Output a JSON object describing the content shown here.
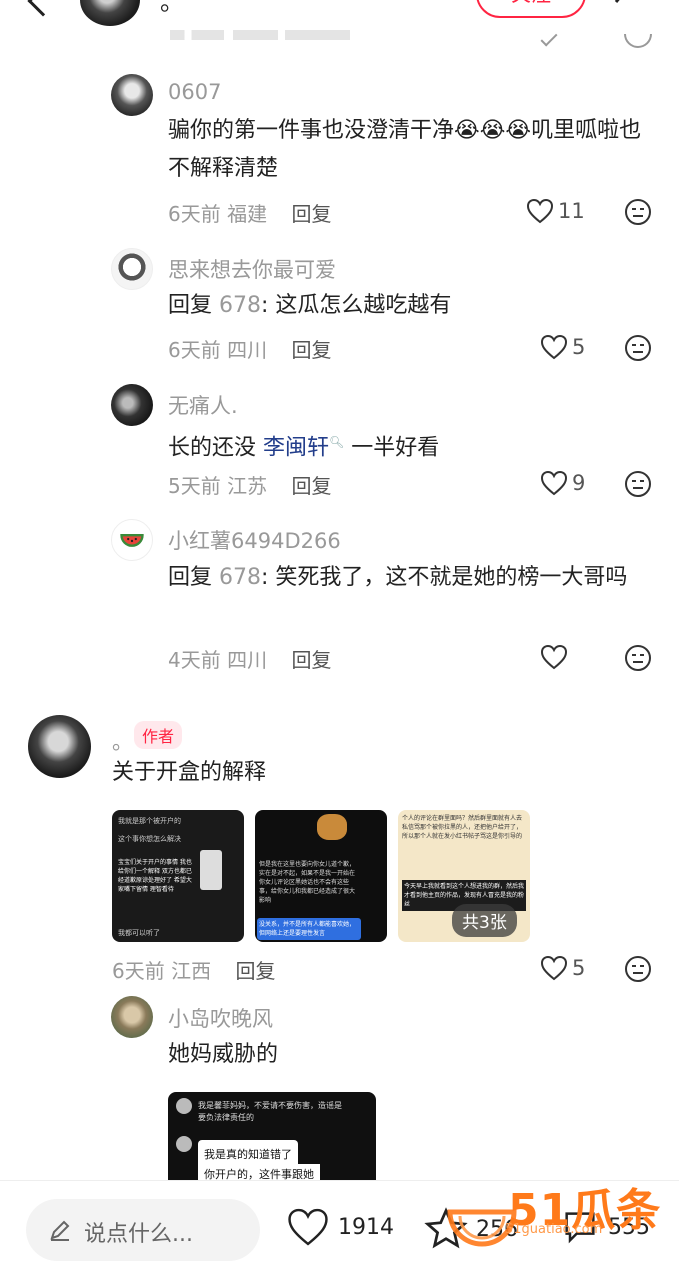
{
  "header": {
    "author_name": "。",
    "follow_label": "关注"
  },
  "comments": [
    {
      "username": "0607",
      "text": "骗你的第一件事也没澄清干净😭😭😭叽里呱啦也不解释清楚",
      "time": "6天前",
      "location": "福建",
      "reply_label": "回复",
      "likes": "11"
    },
    {
      "username": "思来想去你最可爱",
      "reply_prefix": "回复",
      "reply_to": "678",
      "text": ": 这瓜怎么越吃越有",
      "time": "6天前",
      "location": "四川",
      "reply_label": "回复",
      "likes": "5"
    },
    {
      "username": "无痛人.",
      "text_before": "长的还没",
      "link_name": "李闽轩",
      "text_after": "一半好看",
      "time": "5天前",
      "location": "江苏",
      "reply_label": "回复",
      "likes": "9"
    },
    {
      "username": "小红薯6494D266",
      "reply_prefix": "回复",
      "reply_to": "678",
      "text": ": 笑死我了，这不就是她的榜一大哥吗",
      "time": "4天前",
      "location": "四川",
      "reply_label": "回复",
      "likes": ""
    }
  ],
  "author_comment": {
    "username": "。",
    "badge": "作者",
    "text": "关于开盒的解释",
    "image_count": "共3张",
    "time": "6天前",
    "location": "江西",
    "reply_label": "回复",
    "likes": "5",
    "thumb1_lines": [
      "我就是那个被开户的",
      "这个事你想怎么解决",
      "宝宝们关于开户的事情 我也给你们一个解释 双方也都已经道歉原谅处理好了 希望大家嘴下留情 理智看待",
      "我都可以听了"
    ],
    "thumb2_lines": [
      "但是我在这里也要向你女儿道个歉，实在是对不起，如果不是我一开始在你女儿评论区黑她话也不会有这些事，给你女儿和我都已经造成了很大影响",
      "没关系，并不是所有人都能喜欢她，但网络上还是要理性发言"
    ],
    "thumb3_lines": [
      "个人的评论在群里面吗？然后群里面就有人去私信骂那个被你拉黑的人，还把他户给开了，所以那个人就在发小红书帖子骂这是你引导的",
      "今天早上我就看到这个人想进我的群，然后我才看到他主页的作品，发现有人冒充是我的粉丝"
    ]
  },
  "sub_reply": {
    "username": "小岛吹晚风",
    "text": "她妈威胁的",
    "image_lines": [
      "我是馨菲妈妈，不爱请不要伤害，造谣是要负法律责任的",
      "我是真的知道错了",
      "你开户的，这件事跟她"
    ]
  },
  "bottom_bar": {
    "input_placeholder": "说点什么...",
    "likes": "1914",
    "collects": "256",
    "comments": "555"
  },
  "watermark": {
    "text": "51瓜条",
    "url": "51guatiao.com"
  },
  "colors": {
    "accent": "#ff2442",
    "meta": "#999999",
    "link": "#233e8b"
  }
}
